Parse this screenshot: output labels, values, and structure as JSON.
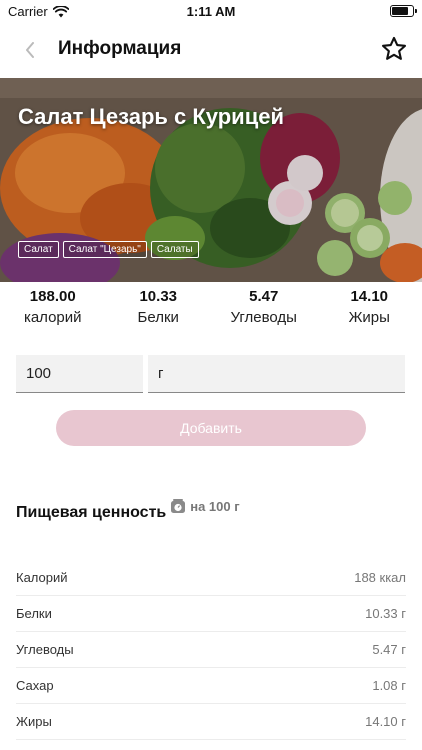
{
  "status": {
    "carrier": "Carrier",
    "time": "1:11 AM",
    "battery_level": 0.85
  },
  "nav": {
    "title": "Информация"
  },
  "hero": {
    "title": "Салат Цезарь с Курицей",
    "tags": [
      "Салат",
      "Салат \"Цезарь\"",
      "Салаты"
    ]
  },
  "macros": [
    {
      "value": "188.00",
      "label": "калорий"
    },
    {
      "value": "10.33",
      "label": "Белки"
    },
    {
      "value": "5.47",
      "label": "Углеводы"
    },
    {
      "value": "14.10",
      "label": "Жиры"
    }
  ],
  "form": {
    "quantity": "100",
    "unit": "г",
    "add_label": "Добавить"
  },
  "nutrition": {
    "title": "Пищевая ценность",
    "per_label": "на 100 г",
    "rows": [
      {
        "name": "Калорий",
        "value": "188 ккал"
      },
      {
        "name": "Белки",
        "value": "10.33 г"
      },
      {
        "name": "Углеводы",
        "value": "5.47 г"
      },
      {
        "name": "Сахар",
        "value": "1.08 г"
      },
      {
        "name": "Жиры",
        "value": "14.10 г"
      }
    ]
  },
  "colors": {
    "accent_button": "#e8c6d0",
    "scale_icon": "#8a8a8a"
  }
}
